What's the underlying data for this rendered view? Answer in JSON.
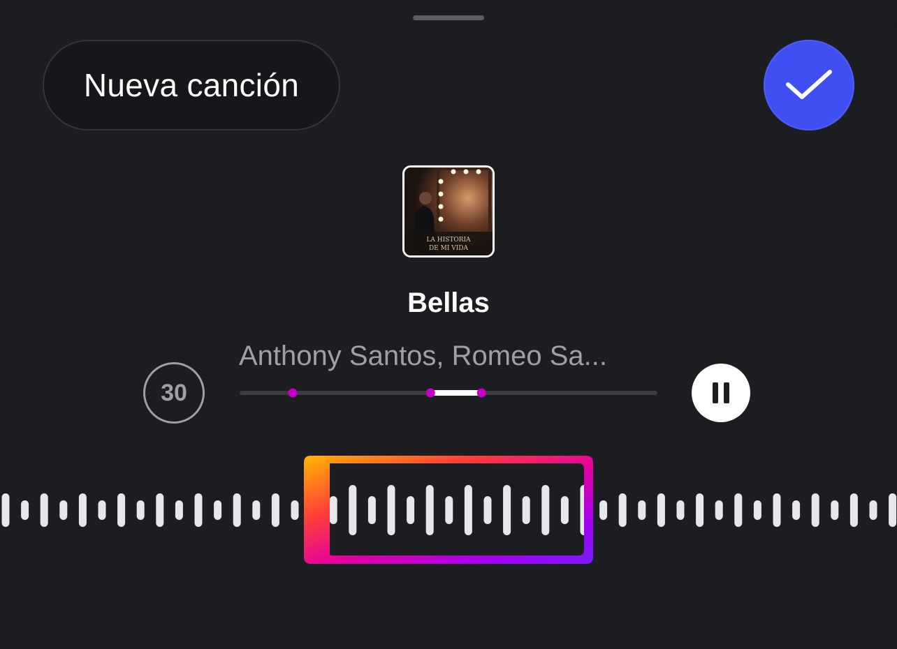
{
  "header": {
    "new_song_label": "Nueva canción",
    "confirm_icon": "checkmark-icon"
  },
  "track": {
    "title": "Bellas",
    "artist": "Anthony Santos, Romeo Sa...",
    "album_art_icon": "album-art"
  },
  "player": {
    "duration_seconds": "30",
    "pause_icon": "pause-icon",
    "markers": [
      0.127,
      0.457,
      0.579
    ],
    "selected_range": [
      0.457,
      0.579
    ]
  },
  "waveform": {
    "selection_colors": [
      "#ffb700",
      "#ff1f6b",
      "#e3009f",
      "#a400f0",
      "#7a1cff"
    ],
    "accent_color": "#3f4ff2",
    "marker_color": "#c300c8"
  }
}
